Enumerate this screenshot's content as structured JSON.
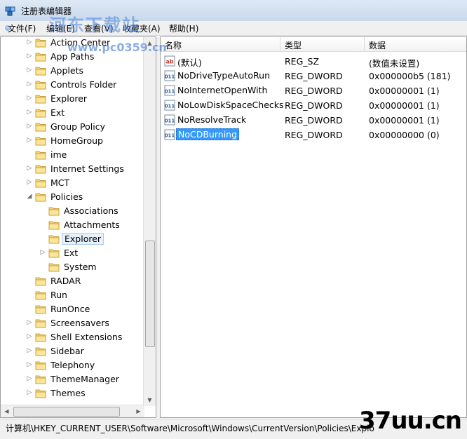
{
  "window": {
    "title": "注册表编辑器"
  },
  "menu": {
    "items": [
      "文件(F)",
      "编辑(E)",
      "查看(V)",
      "收藏夹(A)",
      "帮助(H)"
    ]
  },
  "tree": {
    "items": [
      {
        "label": "Action Center"
      },
      {
        "label": "App Paths"
      },
      {
        "label": "Applets"
      },
      {
        "label": "Controls Folder"
      },
      {
        "label": "Explorer"
      },
      {
        "label": "Ext"
      },
      {
        "label": "Group Policy"
      },
      {
        "label": "HomeGroup"
      },
      {
        "label": "ime"
      },
      {
        "label": "Internet Settings"
      },
      {
        "label": "MCT"
      },
      {
        "label": "Policies"
      },
      {
        "label": "Associations"
      },
      {
        "label": "Attachments"
      },
      {
        "label": "Explorer"
      },
      {
        "label": "Ext"
      },
      {
        "label": "System"
      },
      {
        "label": "RADAR"
      },
      {
        "label": "Run"
      },
      {
        "label": "RunOnce"
      },
      {
        "label": "Screensavers"
      },
      {
        "label": "Shell Extensions"
      },
      {
        "label": "Sidebar"
      },
      {
        "label": "Telephony"
      },
      {
        "label": "ThemeManager"
      },
      {
        "label": "Themes"
      }
    ],
    "selected": "Explorer"
  },
  "list": {
    "headers": {
      "name": "名称",
      "type": "类型",
      "data": "数据"
    },
    "rows": [
      {
        "name": "(默认)",
        "type": "REG_SZ",
        "data": "(数值未设置)",
        "icon": "string-value-icon"
      },
      {
        "name": "NoDriveTypeAutoRun",
        "type": "REG_DWORD",
        "data": "0x000000b5 (181)",
        "icon": "dword-value-icon"
      },
      {
        "name": "NoInternetOpenWith",
        "type": "REG_DWORD",
        "data": "0x00000001 (1)",
        "icon": "dword-value-icon"
      },
      {
        "name": "NoLowDiskSpaceChecks",
        "type": "REG_DWORD",
        "data": "0x00000001 (1)",
        "icon": "dword-value-icon"
      },
      {
        "name": "NoResolveTrack",
        "type": "REG_DWORD",
        "data": "0x00000001 (1)",
        "icon": "dword-value-icon"
      },
      {
        "name": "NoCDBurning",
        "type": "REG_DWORD",
        "data": "0x00000000 (0)",
        "icon": "dword-value-icon"
      }
    ],
    "selected": "NoCDBurning"
  },
  "status": {
    "path": "计算机\\HKEY_CURRENT_USER\\Software\\Microsoft\\Windows\\CurrentVersion\\Policies\\Explo"
  },
  "watermarks": {
    "site_name": "河东下载站",
    "site_url": "www.pc0359.cn",
    "corner": "37uu.cn"
  },
  "colors": {
    "selection": "#3399ff",
    "tree_selection": "#e7f1fb"
  }
}
